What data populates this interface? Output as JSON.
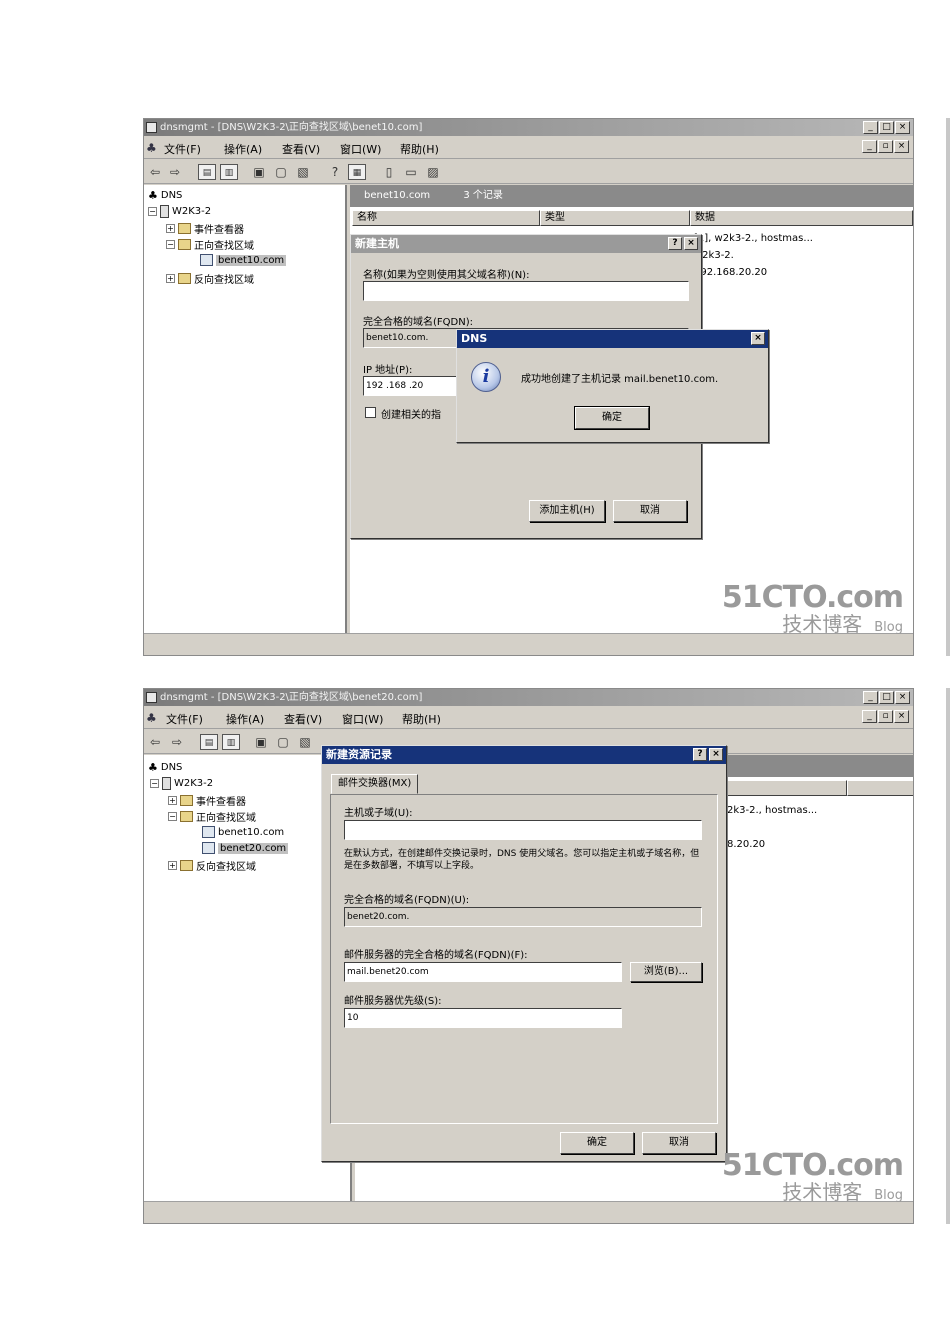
{
  "shot1": {
    "title": "dnsmgmt - [DNS\\W2K3-2\\正向查找区域\\benet10.com]",
    "menu": [
      "文件(F)",
      "操作(A)",
      "查看(V)",
      "窗口(W)",
      "帮助(H)"
    ],
    "tree": {
      "root": "DNS",
      "server": "W2K3-2",
      "event_viewer": "事件查看器",
      "forward_zones": "正向查找区域",
      "zone": "benet10.com",
      "reverse_zones": "反向查找区域"
    },
    "list": {
      "header": "benet10.com",
      "count": "3 个记录",
      "columns": [
        "名称",
        "类型",
        "数据"
      ],
      "data_rows": [
        "[1], w2k3-2., hostmas...",
        "w2k3-2.",
        "192.168.20.20"
      ]
    },
    "new_host": {
      "title": "新建主机",
      "name_label": "名称(如果为空则使用其父域名称)(N):",
      "name_value": "",
      "fqdn_label": "完全合格的域名(FQDN):",
      "fqdn_value": "benet10.com.",
      "ip_label": "IP 地址(P):",
      "ip_value": "192 .168 .20",
      "checkbox_label": "创建相关的指",
      "add_button": "添加主机(H)",
      "cancel_button": "取消"
    },
    "dns_msg": {
      "title": "DNS",
      "message": "成功地创建了主机记录 mail.benet10.com.",
      "ok_button": "确定"
    }
  },
  "shot2": {
    "title": "dnsmgmt - [DNS\\W2K3-2\\正向查找区域\\benet20.com]",
    "menu": [
      "文件(F)",
      "操作(A)",
      "查看(V)",
      "窗口(W)",
      "帮助(H)"
    ],
    "tree": {
      "root": "DNS",
      "server": "W2K3-2",
      "event_viewer": "事件查看器",
      "forward_zones": "正向查找区域",
      "zone1": "benet10.com",
      "zone2": "benet20.com",
      "reverse_zones": "反向查找区域"
    },
    "list": {
      "data_rows": [
        "2k3-2., hostmas...",
        "8.20.20"
      ]
    },
    "new_rr": {
      "title": "新建资源记录",
      "tab": "邮件交换器(MX)",
      "host_label": "主机或子域(U):",
      "host_value": "",
      "help_text": "在默认方式，在创建邮件交换记录时，DNS 使用父域名。您可以指定主机或子域名称，但是在多数部署，不填写以上字段。",
      "fqdn_label": "完全合格的域名(FQDN)(U):",
      "fqdn_value": "benet20.com.",
      "mail_label": "邮件服务器的完全合格的域名(FQDN)(F):",
      "mail_value": "mail.benet20.com",
      "browse_button": "浏览(B)...",
      "priority_label": "邮件服务器优先级(S):",
      "priority_value": "10",
      "ok_button": "确定",
      "cancel_button": "取消"
    }
  },
  "watermark": {
    "brand": "51CTO.com",
    "tagline": "技术博客",
    "blog": "Blog"
  }
}
